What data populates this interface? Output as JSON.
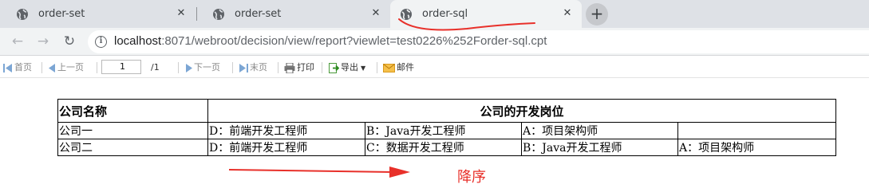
{
  "browser": {
    "tabs": [
      {
        "title": "order-set"
      },
      {
        "title": "order-set"
      },
      {
        "title": "order-sql"
      }
    ],
    "url": {
      "host": "localhost",
      "rest": ":8071/webroot/decision/view/report?viewlet=test0226%252Forder-sql.cpt"
    }
  },
  "report_toolbar": {
    "first": "首页",
    "prev": "上一页",
    "page_value": "1",
    "page_total": "/1",
    "next": "下一页",
    "last": "末页",
    "print": "打印",
    "export": "导出",
    "mail": "邮件"
  },
  "report_table": {
    "headers": {
      "company": "公司名称",
      "positions": "公司的开发岗位"
    },
    "rows": [
      {
        "company": "公司一",
        "cells": [
          "D：前端开发工程师",
          "B：Java开发工程师",
          "A：项目架构师",
          ""
        ]
      },
      {
        "company": "公司二",
        "cells": [
          "D：前端开发工程师",
          "C：数据开发工程师",
          "B：Java开发工程师",
          "A：项目架构师"
        ]
      }
    ]
  },
  "annotation": {
    "text": "降序",
    "color": "#e8302a"
  },
  "colors": {
    "tab_bar": "#dee1e6",
    "active_tab": "#f1f3f4",
    "annotation_red": "#e8302a"
  }
}
